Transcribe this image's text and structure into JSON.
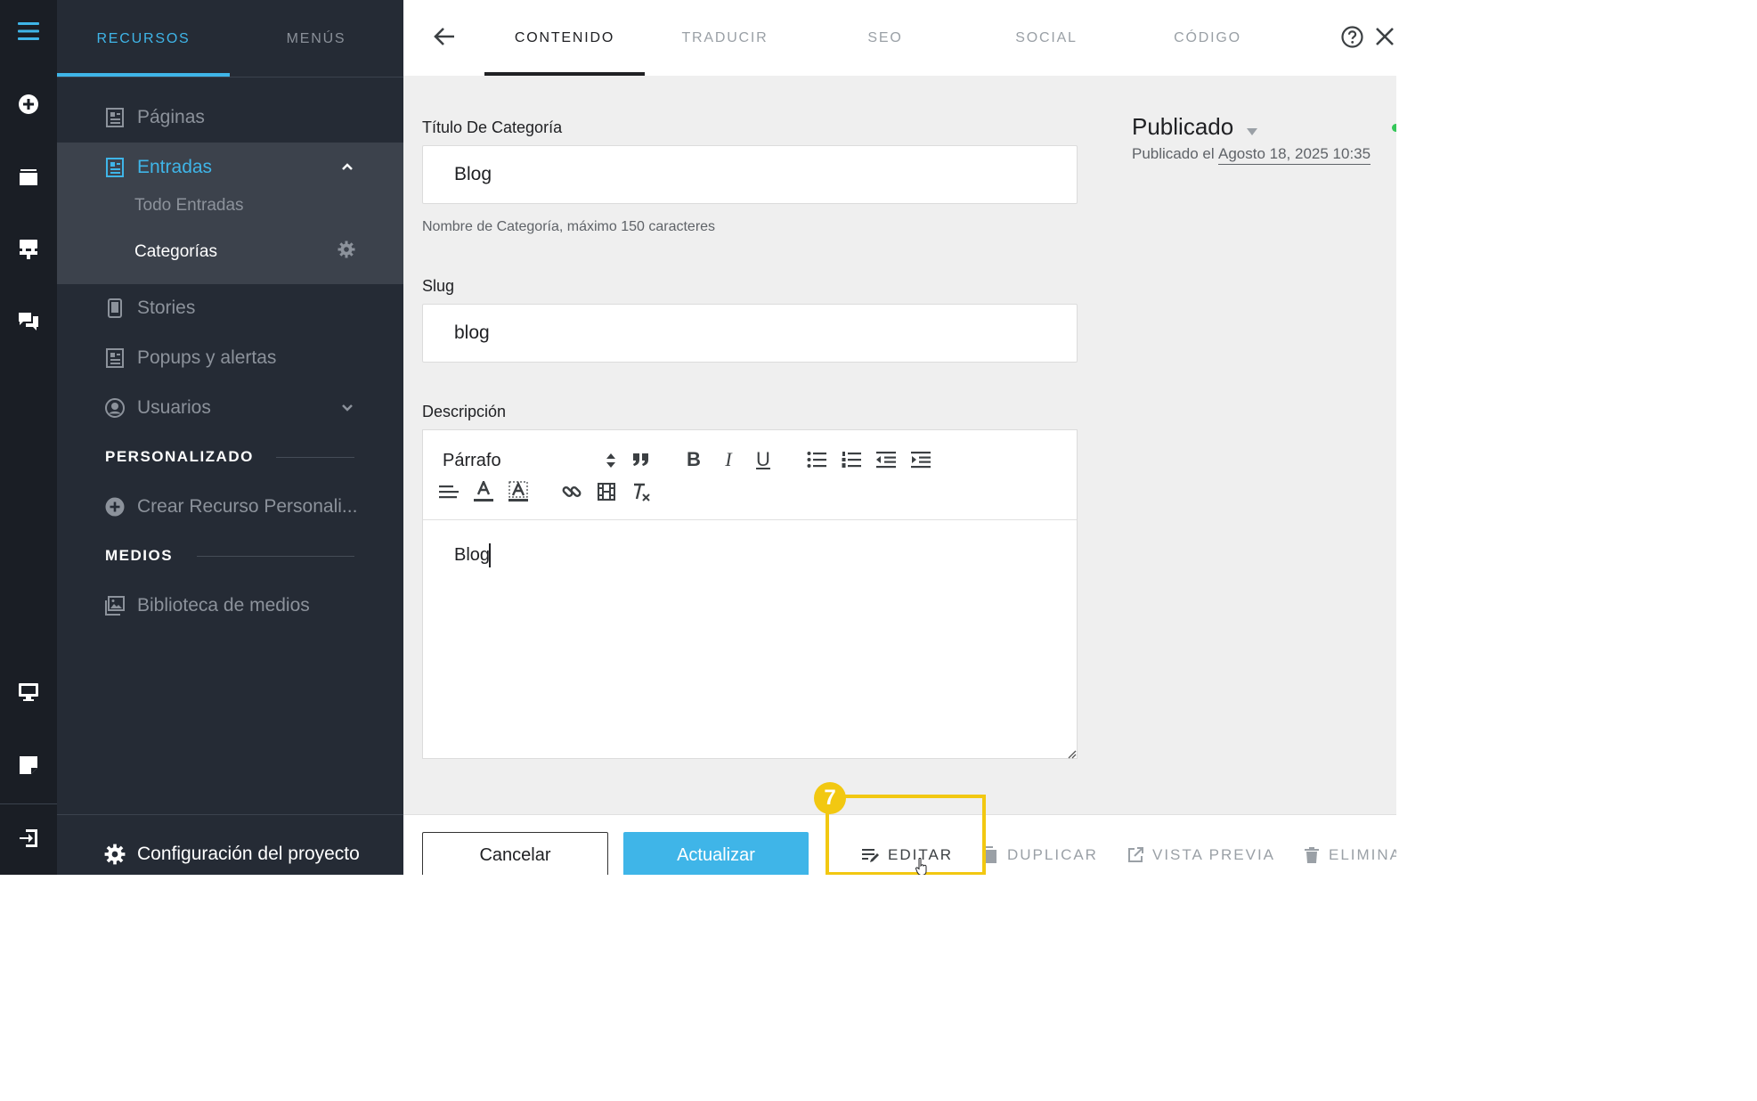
{
  "sidebar": {
    "tabs": [
      {
        "label": "RECURSOS",
        "active": true
      },
      {
        "label": "MENÚS",
        "active": false
      }
    ],
    "items": [
      {
        "label": "Páginas",
        "icon": "page-icon"
      },
      {
        "label": "Entradas",
        "icon": "page-icon",
        "active": true
      },
      {
        "label": "Stories",
        "icon": "phone-icon"
      },
      {
        "label": "Popups y alertas",
        "icon": "page-icon"
      },
      {
        "label": "Usuarios",
        "icon": "user-circle-icon"
      }
    ],
    "subitems": [
      {
        "label": "Todo Entradas"
      },
      {
        "label": "Categorías",
        "active": true
      }
    ],
    "sections": {
      "custom": "PERSONALIZADO",
      "create_custom": "Crear Recurso Personali...",
      "media": "MEDIOS",
      "media_library": "Biblioteca de medios"
    },
    "footer": "Configuración del proyecto"
  },
  "tabs": [
    {
      "label": "CONTENIDO",
      "active": true
    },
    {
      "label": "TRADUCIR",
      "active": false
    },
    {
      "label": "SEO",
      "active": false
    },
    {
      "label": "SOCIAL",
      "active": false
    },
    {
      "label": "CÓDIGO",
      "active": false
    }
  ],
  "form": {
    "title_label": "Título De Categoría",
    "title_value": "Blog",
    "title_help": "Nombre de Categoría, máximo 150 caracteres",
    "slug_label": "Slug",
    "slug_value": "blog",
    "description_label": "Descripción",
    "format_select": "Párrafo",
    "description_value": "Blog"
  },
  "status": {
    "label": "Publicado",
    "published_prefix": "Publicado el",
    "published_date": "Agosto 18, 2025 10:35",
    "color": "#34c759"
  },
  "actions": {
    "cancel": "Cancelar",
    "update": "Actualizar",
    "edit": "EDITAR",
    "duplicate": "DUPLICAR",
    "preview": "VISTA PREVIA",
    "delete": "ELIMINA"
  },
  "highlight": {
    "step": "7",
    "color": "#f2c811"
  },
  "colors": {
    "accent": "#3fb5e8",
    "rail": "#1a1e25",
    "sidebar": "#252b35"
  }
}
